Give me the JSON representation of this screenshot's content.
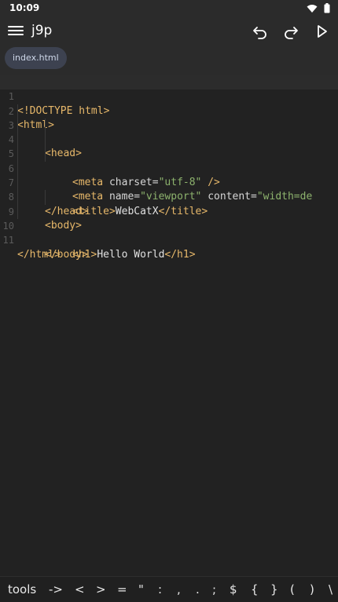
{
  "status": {
    "time": "10:09"
  },
  "toolbar": {
    "title": "j9p",
    "icons": [
      "menu-icon",
      "undo-icon",
      "redo-icon",
      "run-icon"
    ]
  },
  "tabs": [
    {
      "label": "index.html"
    }
  ],
  "editor": {
    "line_numbers": [
      "1",
      "2",
      "3",
      "4",
      "5",
      "6",
      "7",
      "8",
      "9",
      "10",
      "11"
    ],
    "lines": {
      "l1": {
        "t1": "<!DOCTYPE html>"
      },
      "l2": {
        "t1": "<html>"
      },
      "l3": {
        "t1": "<head>"
      },
      "l4": {
        "t1": "<meta",
        "a1": " charset=",
        "s1": "\"utf-8\"",
        "t2": " />"
      },
      "l5": {
        "t1": "<meta",
        "a1": " name=",
        "s1": "\"viewport\"",
        "a2": " content=",
        "s2": "\"width=de"
      },
      "l6": {
        "t1": "<title>",
        "x1": "WebCatX",
        "t2": "</title>"
      },
      "l7": {
        "t1": "</head>"
      },
      "l8": {
        "t1": "<body>"
      },
      "l9": {
        "t1": "<h1>",
        "x1": "Hello World",
        "t2": "</h1>"
      },
      "l10": {
        "t1": "</body>"
      },
      "l11": {
        "t1": "</html>"
      }
    }
  },
  "shortcuts": [
    "tools",
    "->",
    "<",
    ">",
    "=",
    "\"",
    ":",
    ",",
    ".",
    ";",
    "$",
    "{",
    "}",
    "(",
    ")",
    "\\"
  ]
}
